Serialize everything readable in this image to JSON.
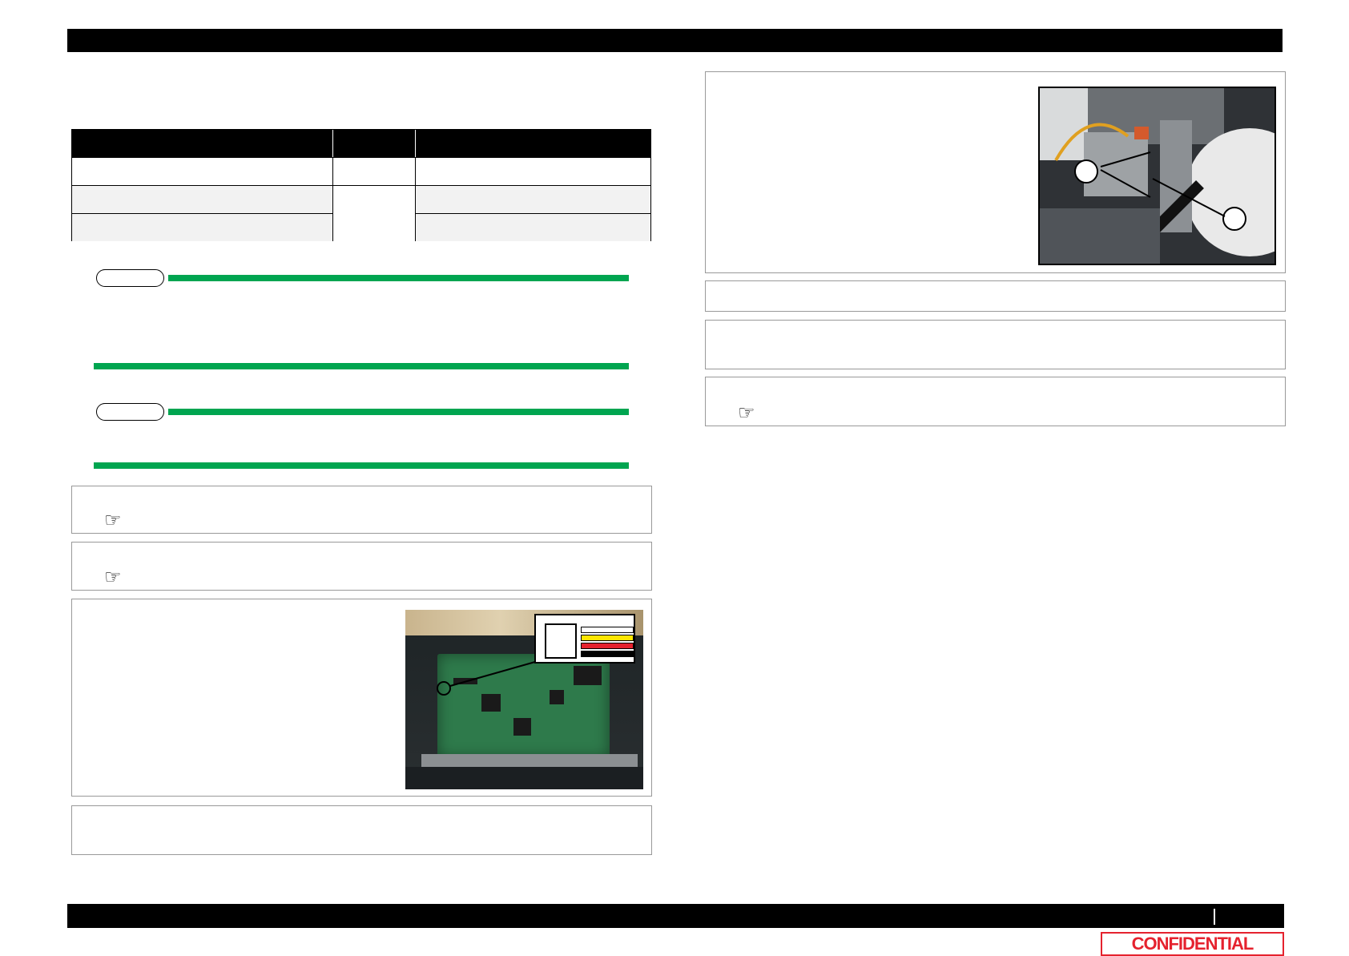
{
  "header": {
    "bar_color": "#000000"
  },
  "table": {
    "columns": 3,
    "rows": 3,
    "header_color": "#000000",
    "row_shading": [
      "#ffffff",
      "#f2f2f2",
      "#f2f2f2"
    ]
  },
  "notes": [
    {
      "name": "note-1",
      "accent": "#00a550"
    },
    {
      "name": "note-2",
      "accent": "#00a550"
    }
  ],
  "steps": {
    "pointer_icon": "pointing-hand-icon",
    "pointer_glyph": "☞"
  },
  "figures": {
    "board_wire_colors": [
      "#ffffff",
      "#ffe600",
      "#e5222e",
      "#000000"
    ],
    "sensor_callouts": 2
  },
  "footer": {
    "confidential_label": "CONFIDENTIAL",
    "confidential_color": "#e5222e"
  }
}
